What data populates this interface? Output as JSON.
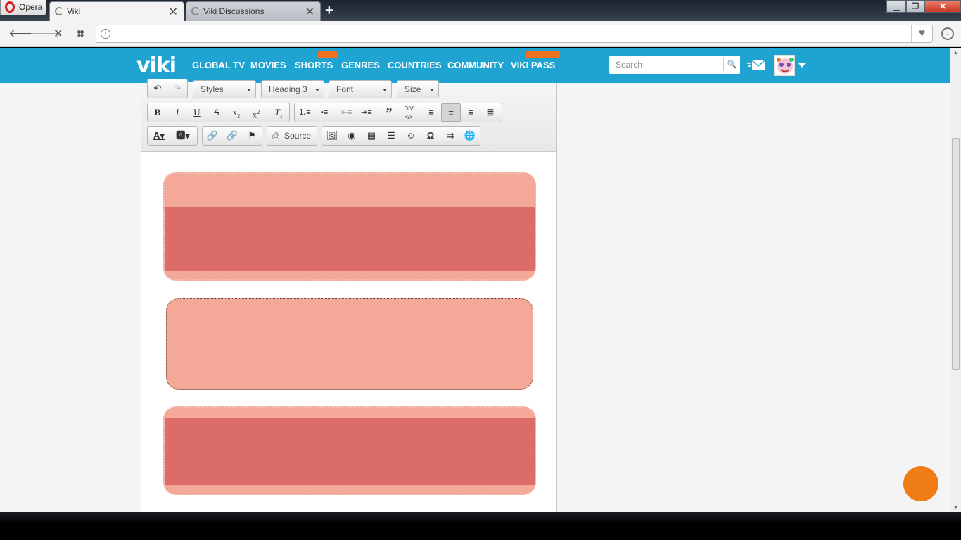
{
  "browser": {
    "menu_label": "Opera",
    "tabs": [
      {
        "title": "Viki",
        "active": true
      },
      {
        "title": "Viki Discussions",
        "active": false
      }
    ],
    "new_tab": "+",
    "address": ""
  },
  "viki": {
    "logo": "viki",
    "nav": [
      "GLOBAL TV",
      "MOVIES",
      "SHORTS",
      "GENRES",
      "COUNTRIES",
      "COMMUNITY",
      "VIKI PASS"
    ],
    "search_placeholder": "Search",
    "accent": "#1fa3d1",
    "badge_color": "#f07020"
  },
  "editor": {
    "combos": {
      "styles": "Styles",
      "heading": "Heading 3",
      "font": "Font",
      "size": "Size"
    },
    "source_label": "Source",
    "box_colors": {
      "light": "#f4a897",
      "dark": "#dc6c67"
    }
  },
  "fab_color": "#f07c16"
}
